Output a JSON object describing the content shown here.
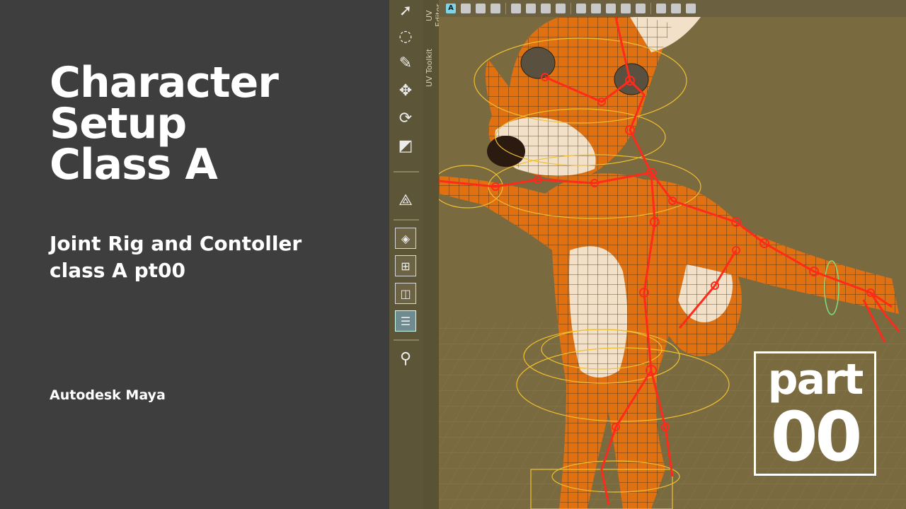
{
  "left": {
    "title_lines": [
      "Character",
      "Setup",
      "Class A"
    ],
    "subtitle_lines": [
      "Joint Rig and Contoller",
      "class A pt00"
    ],
    "software": "Autodesk Maya"
  },
  "viewport": {
    "side_tabs": [
      "UV Editor",
      "UV Toolkit"
    ],
    "toolbox_icons": [
      "select-tool-icon",
      "lasso-select-icon",
      "paint-select-icon",
      "move-tool-icon",
      "rotate-tool-icon",
      "scale-tool-icon",
      "joint-tool-icon",
      "single-view-icon",
      "four-view-icon",
      "two-view-icon",
      "outliner-icon",
      "search-icon"
    ],
    "status_icon_letter": "A"
  },
  "badge": {
    "label": "part",
    "number": "00"
  },
  "colors": {
    "panel_bg": "#3e3e3e",
    "viewport_bg": "#7a6a40",
    "skin_orange": "#e07010",
    "joint_red": "#ff2a1a",
    "controller_yellow": "#f0c030",
    "text_white": "#ffffff"
  }
}
